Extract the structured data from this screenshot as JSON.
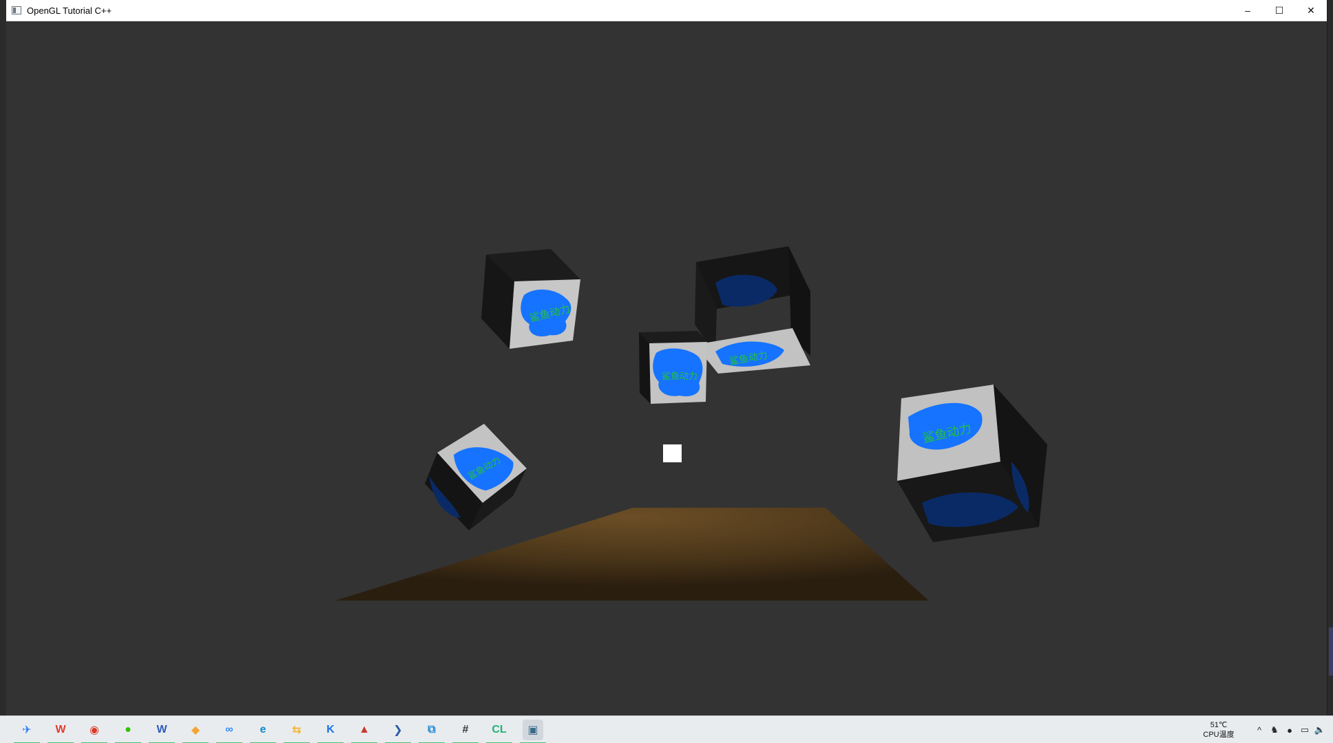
{
  "window": {
    "title": "OpenGL Tutorial C++",
    "controls": {
      "minimize": "–",
      "maximize": "☐",
      "close": "✕"
    }
  },
  "scene": {
    "background_color": "#333333",
    "floor_color": "#5a4222",
    "cube_texture_text": "鲨鱼动力",
    "cube_texture_colors": {
      "face": "#c9c9c9",
      "blob": "#1673ff",
      "text": "#23c23a",
      "dark": "#151515"
    },
    "light_cube_color": "#ffffff"
  },
  "taskbar": {
    "apps": [
      {
        "name": "feishu-icon",
        "glyph": "✈",
        "color": "#2f7bf5"
      },
      {
        "name": "wps-icon",
        "glyph": "W",
        "color": "#e23b2e"
      },
      {
        "name": "radeon-icon",
        "glyph": "◉",
        "color": "#d83a2a"
      },
      {
        "name": "wechat-icon",
        "glyph": "●",
        "color": "#2dc100"
      },
      {
        "name": "word-icon",
        "glyph": "W",
        "color": "#2b5bb8"
      },
      {
        "name": "sketch-icon",
        "glyph": "◆",
        "color": "#f2a530"
      },
      {
        "name": "baidu-netdisk-icon",
        "glyph": "∞",
        "color": "#2f8cff"
      },
      {
        "name": "edge-icon",
        "glyph": "e",
        "color": "#0f8ac9"
      },
      {
        "name": "flow-icon",
        "glyph": "⇆",
        "color": "#f3b52a"
      },
      {
        "name": "k-app-icon",
        "glyph": "K",
        "color": "#1a73e8"
      },
      {
        "name": "game-icon",
        "glyph": "▲",
        "color": "#c9372c"
      },
      {
        "name": "powershell-icon",
        "glyph": "❯",
        "color": "#2a5aa6"
      },
      {
        "name": "vscode-icon",
        "glyph": "⧉",
        "color": "#1f8ad3"
      },
      {
        "name": "hash-app-icon",
        "glyph": "#",
        "color": "#333333"
      },
      {
        "name": "clion-icon",
        "glyph": "CL",
        "color": "#22b378"
      },
      {
        "name": "opengl-window-icon",
        "glyph": "▣",
        "color": "#3a6b8a"
      }
    ],
    "cpu_temp": "51℃",
    "cpu_label": "CPU温度",
    "tray": [
      {
        "name": "chevron-up-icon",
        "glyph": "^"
      },
      {
        "name": "qq-icon",
        "glyph": "♞"
      },
      {
        "name": "wechat-tray-icon",
        "glyph": "●"
      },
      {
        "name": "network-icon",
        "glyph": "▭"
      },
      {
        "name": "volume-icon",
        "glyph": "🔈"
      }
    ]
  }
}
